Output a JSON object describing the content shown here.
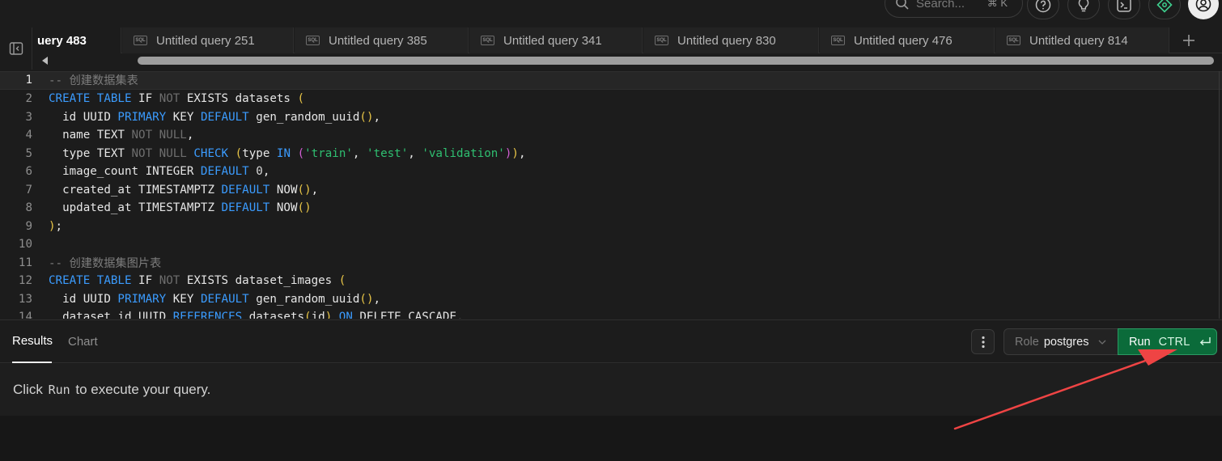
{
  "topbar": {
    "search_placeholder": "Search...",
    "search_shortcut": "⌘ K",
    "icons": [
      "help-icon",
      "lightbulb-icon",
      "terminal-icon",
      "feedback-icon",
      "avatar"
    ]
  },
  "tabs": [
    {
      "label": "uery 483",
      "active": true
    },
    {
      "label": "Untitled query 251",
      "active": false
    },
    {
      "label": "Untitled query 385",
      "active": false
    },
    {
      "label": "Untitled query 341",
      "active": false
    },
    {
      "label": "Untitled query 830",
      "active": false
    },
    {
      "label": "Untitled query 476",
      "active": false
    },
    {
      "label": "Untitled query 814",
      "active": false
    }
  ],
  "tab_sql_badge": "SQL",
  "editor": {
    "line_numbers": [
      "1",
      "2",
      "3",
      "4",
      "5",
      "6",
      "7",
      "8",
      "9",
      "10",
      "11",
      "12",
      "13",
      "14"
    ],
    "lines": [
      "-- 创建数据集表",
      "CREATE TABLE IF NOT EXISTS datasets (",
      "  id UUID PRIMARY KEY DEFAULT gen_random_uuid(),",
      "  name TEXT NOT NULL,",
      "  type TEXT NOT NULL CHECK (type IN ('train', 'test', 'validation')),",
      "  image_count INTEGER DEFAULT 0,",
      "  created_at TIMESTAMPTZ DEFAULT NOW(),",
      "  updated_at TIMESTAMPTZ DEFAULT NOW()",
      ");",
      "",
      "-- 创建数据集图片表",
      "CREATE TABLE IF NOT EXISTS dataset_images (",
      "  id UUID PRIMARY KEY DEFAULT gen_random_uuid(),",
      "  dataset_id UUID REFERENCES datasets(id) ON DELETE CASCADE,"
    ]
  },
  "results": {
    "tabs": [
      "Results",
      "Chart"
    ],
    "role_label": "Role",
    "role_value": "postgres",
    "run_label": "Run",
    "run_shortcut": "CTRL",
    "empty_prefix": "Click",
    "empty_run": "Run",
    "empty_suffix": "to execute your query."
  },
  "colors": {
    "accent_green": "#0b6b3a",
    "annotation_arrow": "#ef4444"
  }
}
